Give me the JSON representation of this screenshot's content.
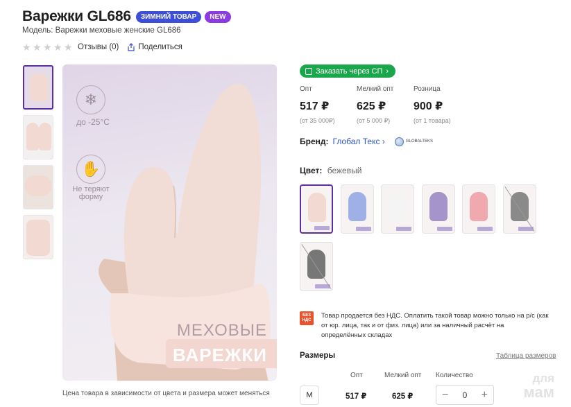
{
  "product": {
    "title": "Варежки GL686",
    "badge_winter": "ЗИМНИЙ ТОВАР",
    "badge_new": "NEW",
    "model": "Модель: Варежки меховые женские GL686",
    "reviews": "Отзывы (0)",
    "share": "Поделиться",
    "rating_stars": 0
  },
  "image": {
    "temp_text": "до -25°C",
    "warm_text_1": "Не теряют",
    "warm_text_2": "форму",
    "promo_top": "МЕХОВЫЕ",
    "promo_bottom": "ВАРЕЖКИ",
    "caption": "Цена товара в зависимости от цвета и размера может меняться"
  },
  "order_button": "Заказать через СП",
  "prices": [
    {
      "label": "Опт",
      "value": "517 ₽",
      "note": "(от 35 000₽)"
    },
    {
      "label": "Мелкий опт",
      "value": "625 ₽",
      "note": "(от 5 000 ₽)"
    },
    {
      "label": "Розница",
      "value": "900 ₽",
      "note": "(от 1 товара)"
    }
  ],
  "brand": {
    "label": "Бренд:",
    "name": "Глобал Текс",
    "logo_text": "GLOBALTEKS"
  },
  "color": {
    "label": "Цвет:",
    "value": "бежевый",
    "swatch_colors": [
      "#f2d9d2",
      "#9fb0e6",
      "#f4f4f4",
      "#a594c9",
      "#f0a9ae",
      "#8a8a8a",
      "#777777"
    ]
  },
  "vat": {
    "badge_1": "БЕЗ",
    "badge_2": "НДС",
    "text": "Товар продается без НДС. Оплатить такой товар можно только на р/с (как от юр. лица, так и от физ. лица) или за наличный расчёт на определённых складах"
  },
  "sizes": {
    "title": "Размеры",
    "table_link": "Таблица размеров",
    "head_opt": "Опт",
    "head_small": "Мелкий опт",
    "head_qty": "Количество",
    "size": "M",
    "opt": "517 ₽",
    "small": "625 ₽",
    "qty": "0",
    "minus": "−",
    "plus": "+"
  },
  "watermark": {
    "line1": "для",
    "line2": "мам"
  }
}
